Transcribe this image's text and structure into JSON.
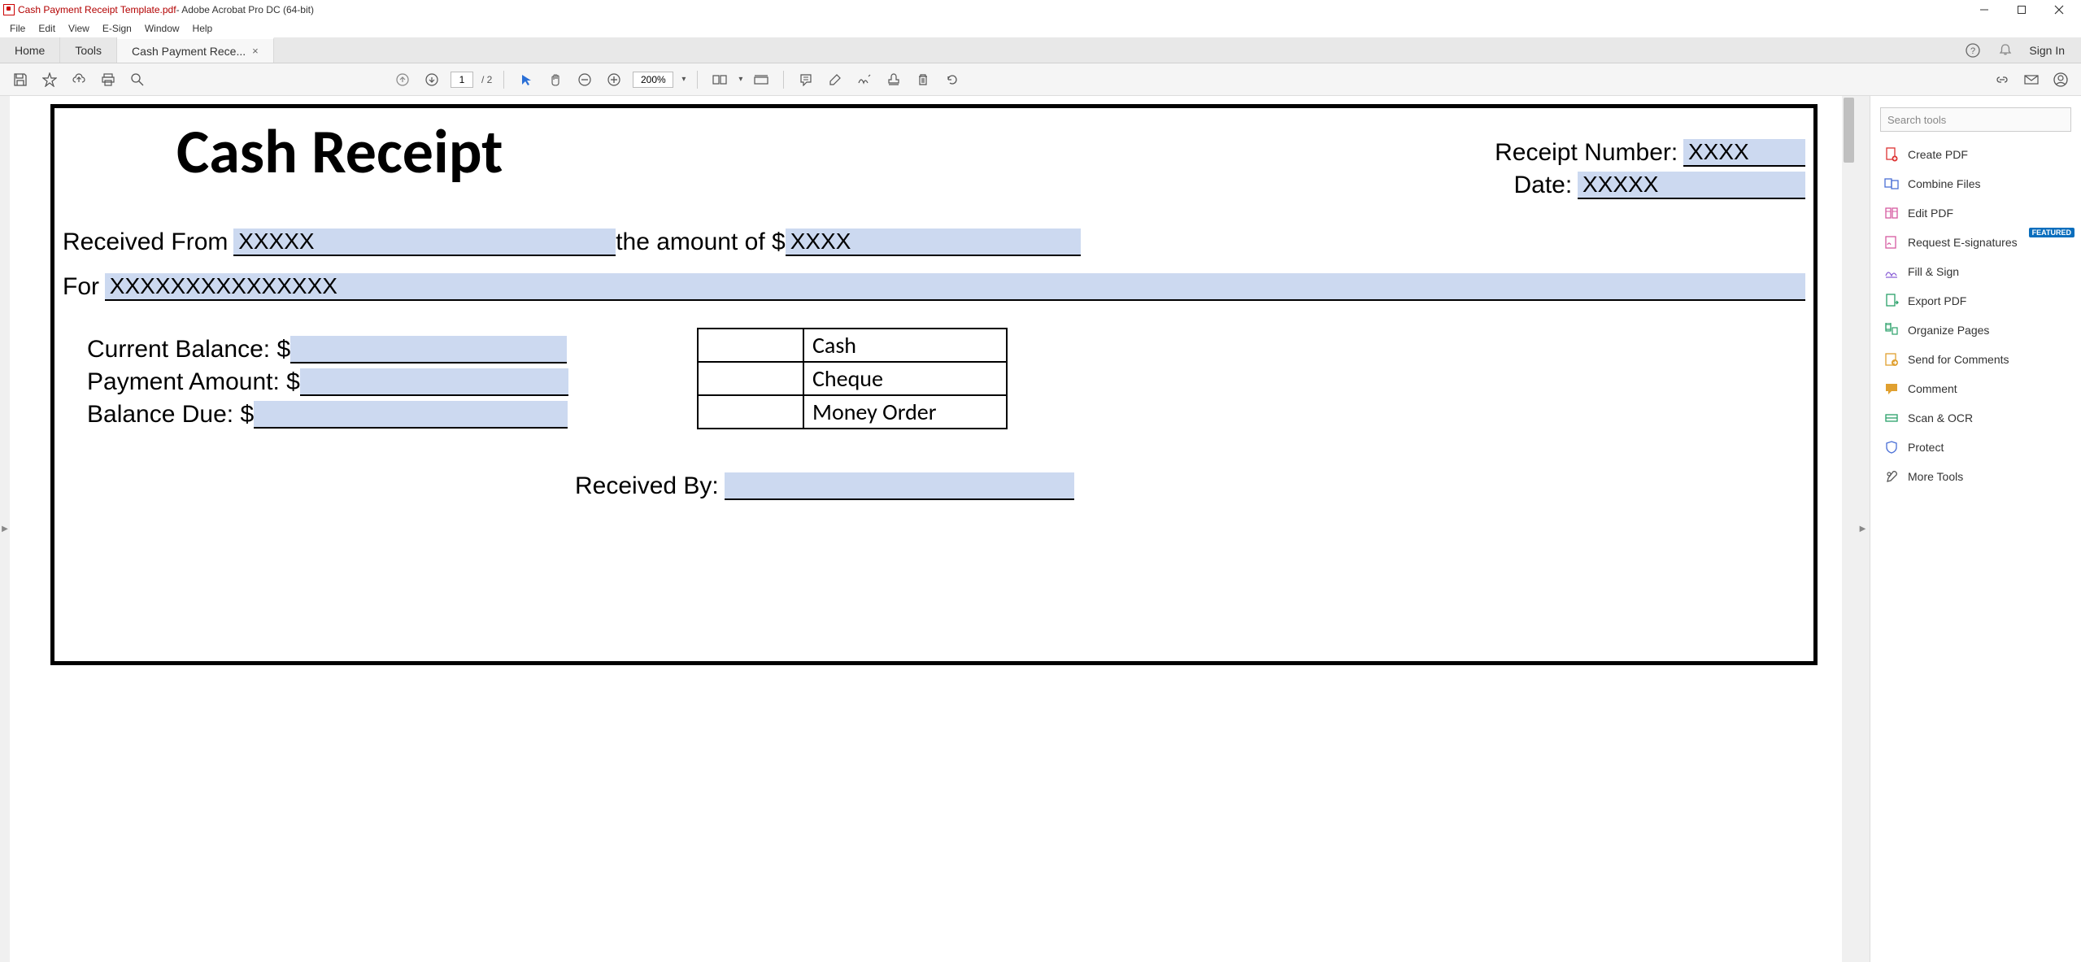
{
  "window": {
    "title_doc": "Cash Payment Receipt Template.pdf",
    "title_app": " - Adobe Acrobat Pro DC (64-bit)"
  },
  "menubar": [
    "File",
    "Edit",
    "View",
    "E-Sign",
    "Window",
    "Help"
  ],
  "tabs": {
    "home": "Home",
    "tools": "Tools",
    "document": "Cash Payment Rece...",
    "sign_in": "Sign In"
  },
  "toolbar": {
    "page_current": "1",
    "page_total": "/ 2",
    "zoom": "200%"
  },
  "right_panel": {
    "search_placeholder": "Search tools",
    "items": [
      {
        "label": "Create PDF"
      },
      {
        "label": "Combine Files"
      },
      {
        "label": "Edit PDF"
      },
      {
        "label": "Request E-signatures",
        "featured": "FEATURED"
      },
      {
        "label": "Fill & Sign"
      },
      {
        "label": "Export PDF"
      },
      {
        "label": "Organize Pages"
      },
      {
        "label": "Send for Comments"
      },
      {
        "label": "Comment"
      },
      {
        "label": "Scan & OCR"
      },
      {
        "label": "Protect"
      },
      {
        "label": "More Tools"
      }
    ]
  },
  "receipt": {
    "title": "Cash Receipt",
    "receipt_number_label": "Receipt Number:",
    "receipt_number_value": "XXXX",
    "date_label": "Date:",
    "date_value": "XXXXX",
    "received_from_label": "Received From",
    "received_from_value": "XXXXX",
    "amount_label": "the amount of $",
    "amount_value": "XXXX",
    "for_label": "For",
    "for_value": "XXXXXXXXXXXXXXX",
    "current_balance_label": "Current Balance: $",
    "payment_amount_label": "Payment Amount: $",
    "balance_due_label": "Balance Due: $",
    "cash": "Cash",
    "cheque": "Cheque",
    "money_order": "Money Order",
    "received_by_label": "Received By:"
  }
}
